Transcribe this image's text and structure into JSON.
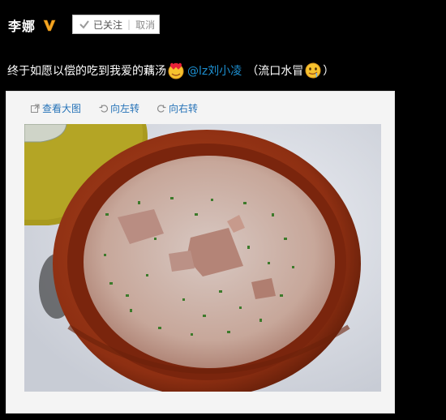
{
  "user": {
    "name": "李娜",
    "badge_icon": "verified-v-icon",
    "badge_color": "#f5a623"
  },
  "follow": {
    "status_label": "已关注",
    "separator": "|",
    "cancel_label": "取消"
  },
  "post": {
    "text": "终于如愿以偿的吃到我爱的藕汤",
    "emoji_1": "heart-eyes-emoji",
    "mention": "@lz刘小凌",
    "paren_open": "（流口水冒",
    "emoji_2": "drool-emoji",
    "paren_close": "）"
  },
  "toolbar": {
    "view_large": "查看大图",
    "rotate_left": "向左转",
    "rotate_right": "向右转"
  },
  "photo": {
    "subject": "lotus-root-soup-in-clay-pot"
  },
  "colors": {
    "background": "#000000",
    "link": "#1d8fd0",
    "toolbar_link": "#2673b8"
  }
}
